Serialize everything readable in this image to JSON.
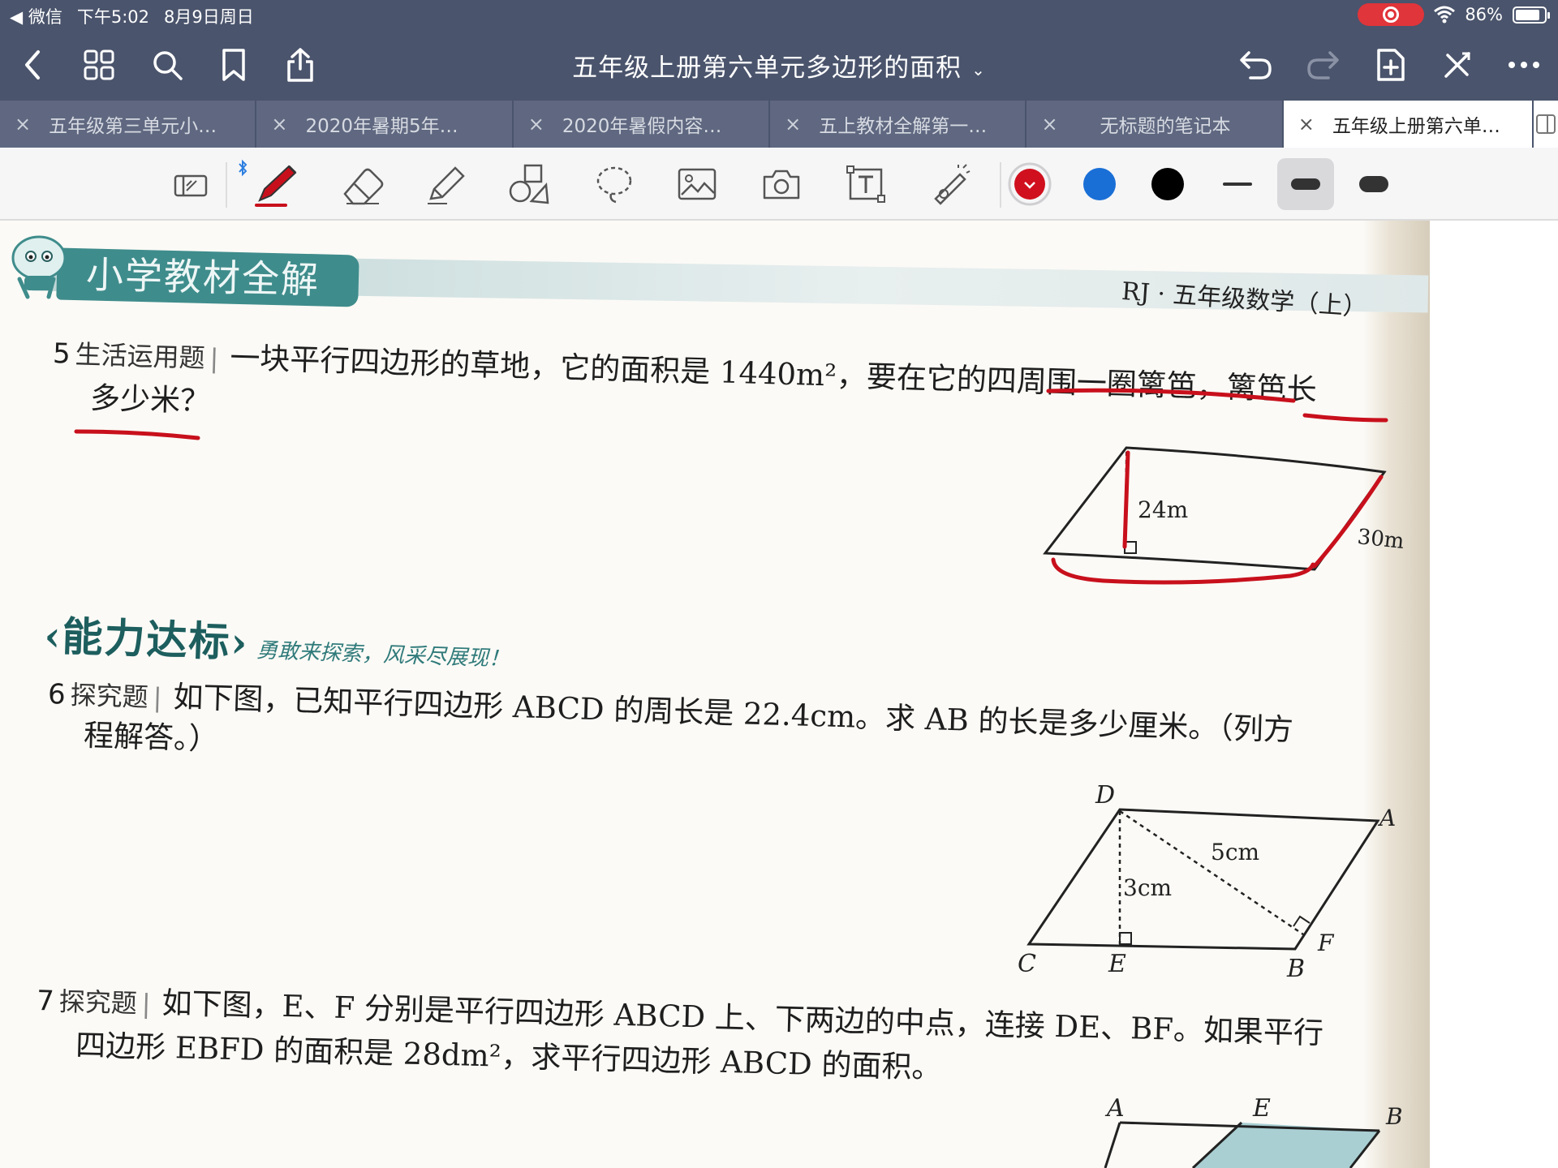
{
  "status_bar": {
    "back_app": "◀ 微信",
    "time": "下午5:02",
    "date": "8月9日周日",
    "battery": "86%",
    "battery_level": 0.86
  },
  "nav": {
    "title": "五年级上册第六单元多边形的面积",
    "caret": "⌄"
  },
  "tabs": [
    {
      "label": "五年级第三单元小…",
      "active": false
    },
    {
      "label": "2020年暑期5年…",
      "active": false
    },
    {
      "label": "2020年暑假内容…",
      "active": false
    },
    {
      "label": "五上教材全解第一…",
      "active": false
    },
    {
      "label": "无标题的笔记本",
      "active": false
    },
    {
      "label": "五年级上册第六单…",
      "active": true
    }
  ],
  "toolbar": {
    "colors": [
      "#d0101e",
      "#1a6fd6",
      "#000000"
    ],
    "selected_color": "#d0101e",
    "ink_color": "#c8101c"
  },
  "page": {
    "book_banner": "小学教材全解",
    "book_label": "RJ · 五年级数学（上）",
    "q5": {
      "num": "5",
      "tag": "生活运用题",
      "line1": "一块平行四边形的草地，它的面积是 1440m²，要在它的四周围一圈篱笆，篱笆长",
      "line2": "多少米？",
      "fig_height": "24m",
      "fig_side": "30m"
    },
    "section": {
      "title": "‹能力达标›",
      "subtitle": "勇敢来探索，风采尽展现！"
    },
    "q6": {
      "num": "6",
      "tag": "探究题",
      "line1": "如下图，已知平行四边形 ABCD 的周长是 22.4cm。求 AB 的长是多少厘米。（列方",
      "line2": "程解答。）",
      "labels": {
        "D": "D",
        "A": "A",
        "C": "C",
        "E": "E",
        "B": "B",
        "F": "F",
        "h1": "3cm",
        "h2": "5cm"
      }
    },
    "q7": {
      "num": "7",
      "tag": "探究题",
      "line1": "如下图，E、F 分别是平行四边形 ABCD 上、下两边的中点，连接 DE、BF。如果平行",
      "line2": "四边形 EBFD 的面积是 28dm²，求平行四边形 ABCD 的面积。",
      "labels": {
        "A": "A",
        "E": "E",
        "B": "B"
      }
    }
  }
}
